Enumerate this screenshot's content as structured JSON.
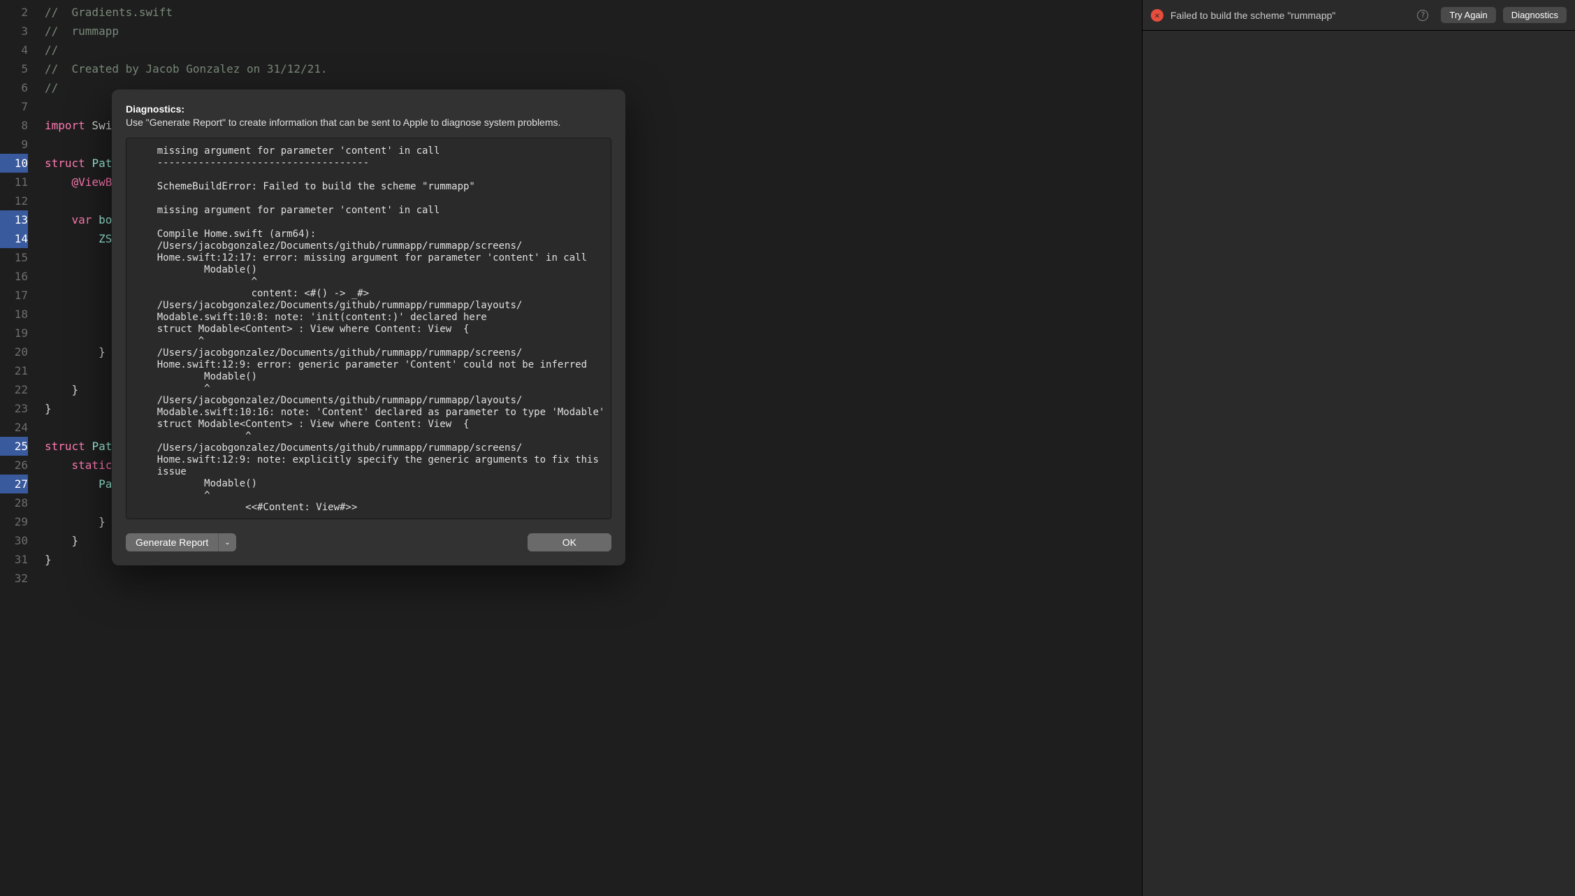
{
  "gutter": {
    "start": 2,
    "end": 32,
    "marked_lines": [
      10,
      13,
      14,
      25,
      27
    ]
  },
  "code": {
    "lines": [
      {
        "n": 2,
        "segments": [
          {
            "cls": "comment",
            "text": "//  Gradients.swift"
          }
        ]
      },
      {
        "n": 3,
        "segments": [
          {
            "cls": "comment",
            "text": "//  rummapp"
          }
        ]
      },
      {
        "n": 4,
        "segments": [
          {
            "cls": "comment",
            "text": "//"
          }
        ]
      },
      {
        "n": 5,
        "segments": [
          {
            "cls": "comment",
            "text": "//  Created by Jacob Gonzalez on 31/12/21."
          }
        ]
      },
      {
        "n": 6,
        "segments": [
          {
            "cls": "comment",
            "text": "//"
          }
        ]
      },
      {
        "n": 7,
        "segments": []
      },
      {
        "n": 8,
        "segments": [
          {
            "cls": "keyword",
            "text": "import"
          },
          {
            "cls": "identifier",
            "text": " Swif"
          }
        ]
      },
      {
        "n": 9,
        "segments": []
      },
      {
        "n": 10,
        "segments": [
          {
            "cls": "keyword",
            "text": "struct"
          },
          {
            "cls": "identifier",
            "text": " "
          },
          {
            "cls": "type",
            "text": "Patt"
          }
        ]
      },
      {
        "n": 11,
        "segments": [
          {
            "cls": "identifier",
            "text": "    "
          },
          {
            "cls": "decorator",
            "text": "@ViewBu"
          }
        ]
      },
      {
        "n": 12,
        "segments": []
      },
      {
        "n": 13,
        "segments": [
          {
            "cls": "identifier",
            "text": "    "
          },
          {
            "cls": "keyword",
            "text": "var"
          },
          {
            "cls": "identifier",
            "text": " "
          },
          {
            "cls": "type",
            "text": "bo"
          }
        ]
      },
      {
        "n": 14,
        "segments": [
          {
            "cls": "identifier",
            "text": "        "
          },
          {
            "cls": "type",
            "text": "ZSt"
          }
        ]
      },
      {
        "n": 15,
        "segments": []
      },
      {
        "n": 16,
        "segments": []
      },
      {
        "n": 17,
        "segments": []
      },
      {
        "n": 18,
        "segments": []
      },
      {
        "n": 19,
        "segments": []
      },
      {
        "n": 20,
        "segments": [
          {
            "cls": "identifier",
            "text": "        }"
          }
        ]
      },
      {
        "n": 21,
        "segments": []
      },
      {
        "n": 22,
        "segments": [
          {
            "cls": "identifier",
            "text": "    }"
          }
        ]
      },
      {
        "n": 23,
        "segments": [
          {
            "cls": "identifier",
            "text": "}"
          }
        ]
      },
      {
        "n": 24,
        "segments": []
      },
      {
        "n": 25,
        "segments": [
          {
            "cls": "keyword",
            "text": "struct"
          },
          {
            "cls": "identifier",
            "text": " "
          },
          {
            "cls": "type",
            "text": "Patt"
          }
        ]
      },
      {
        "n": 26,
        "segments": [
          {
            "cls": "identifier",
            "text": "    "
          },
          {
            "cls": "keyword",
            "text": "static"
          }
        ]
      },
      {
        "n": 27,
        "segments": [
          {
            "cls": "identifier",
            "text": "        "
          },
          {
            "cls": "type",
            "text": "Pat"
          }
        ]
      },
      {
        "n": 28,
        "segments": []
      },
      {
        "n": 29,
        "segments": [
          {
            "cls": "identifier",
            "text": "        }"
          }
        ]
      },
      {
        "n": 30,
        "segments": [
          {
            "cls": "identifier",
            "text": "    }"
          }
        ]
      },
      {
        "n": 31,
        "segments": [
          {
            "cls": "identifier",
            "text": "}"
          }
        ]
      },
      {
        "n": 32,
        "segments": []
      }
    ]
  },
  "status": {
    "error_text": "Failed to build the scheme \"rummapp\"",
    "try_again_label": "Try Again",
    "diagnostics_label": "Diagnostics"
  },
  "dialog": {
    "title": "Diagnostics:",
    "subtitle": "Use \"Generate Report\" to create information that can be sent to Apple to diagnose system problems.",
    "content": "    missing argument for parameter 'content' in call\n    ------------------------------------\n\n    SchemeBuildError: Failed to build the scheme \"rummapp\"\n\n    missing argument for parameter 'content' in call\n\n    Compile Home.swift (arm64):\n    /Users/jacobgonzalez/Documents/github/rummapp/rummapp/screens/\n    Home.swift:12:17: error: missing argument for parameter 'content' in call\n            Modable()\n                    ^\n                    content: <#() -> _#>\n    /Users/jacobgonzalez/Documents/github/rummapp/rummapp/layouts/\n    Modable.swift:10:8: note: 'init(content:)' declared here\n    struct Modable<Content> : View where Content: View  {\n           ^\n    /Users/jacobgonzalez/Documents/github/rummapp/rummapp/screens/\n    Home.swift:12:9: error: generic parameter 'Content' could not be inferred\n            Modable()\n            ^\n    /Users/jacobgonzalez/Documents/github/rummapp/rummapp/layouts/\n    Modable.swift:10:16: note: 'Content' declared as parameter to type 'Modable'\n    struct Modable<Content> : View where Content: View  {\n                   ^\n    /Users/jacobgonzalez/Documents/github/rummapp/rummapp/screens/\n    Home.swift:12:9: note: explicitly specify the generic arguments to fix this\n    issue\n            Modable()\n            ^\n                   <<#Content: View#>>",
    "generate_report_label": "Generate Report",
    "ok_label": "OK"
  }
}
